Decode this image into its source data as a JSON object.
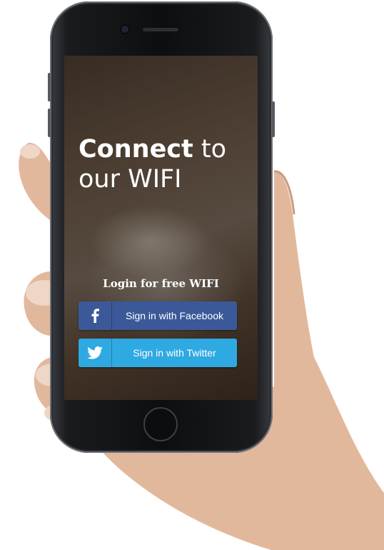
{
  "headline": {
    "bold": "Connect",
    "rest_line1": " to",
    "line2": "our WIFI"
  },
  "login_text": "Login for free WIFI",
  "buttons": {
    "facebook": {
      "label": "Sign in with Facebook",
      "icon": "facebook-icon",
      "color": "#3b5998"
    },
    "twitter": {
      "label": "Sign in with Twitter",
      "icon": "twitter-icon",
      "color": "#2fa9e1"
    }
  }
}
